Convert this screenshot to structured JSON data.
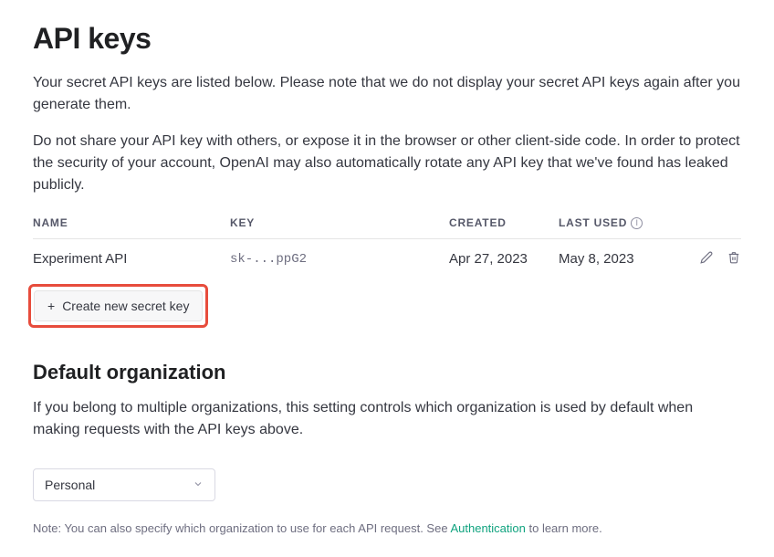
{
  "page": {
    "title": "API keys",
    "intro1": "Your secret API keys are listed below. Please note that we do not display your secret API keys again after you generate them.",
    "intro2": "Do not share your API key with others, or expose it in the browser or other client-side code. In order to protect the security of your account, OpenAI may also automatically rotate any API key that we've found has leaked publicly."
  },
  "table": {
    "headers": {
      "name": "NAME",
      "key": "KEY",
      "created": "CREATED",
      "last_used": "LAST USED"
    },
    "rows": [
      {
        "name": "Experiment API",
        "key": "sk-...ppG2",
        "created": "Apr 27, 2023",
        "last_used": "May 8, 2023"
      }
    ]
  },
  "create_button": {
    "label": "Create new secret key"
  },
  "org_section": {
    "heading": "Default organization",
    "description": "If you belong to multiple organizations, this setting controls which organization is used by default when making requests with the API keys above.",
    "selected": "Personal",
    "note_prefix": "Note: You can also specify which organization to use for each API request. See ",
    "note_link": "Authentication",
    "note_suffix": " to learn more."
  }
}
